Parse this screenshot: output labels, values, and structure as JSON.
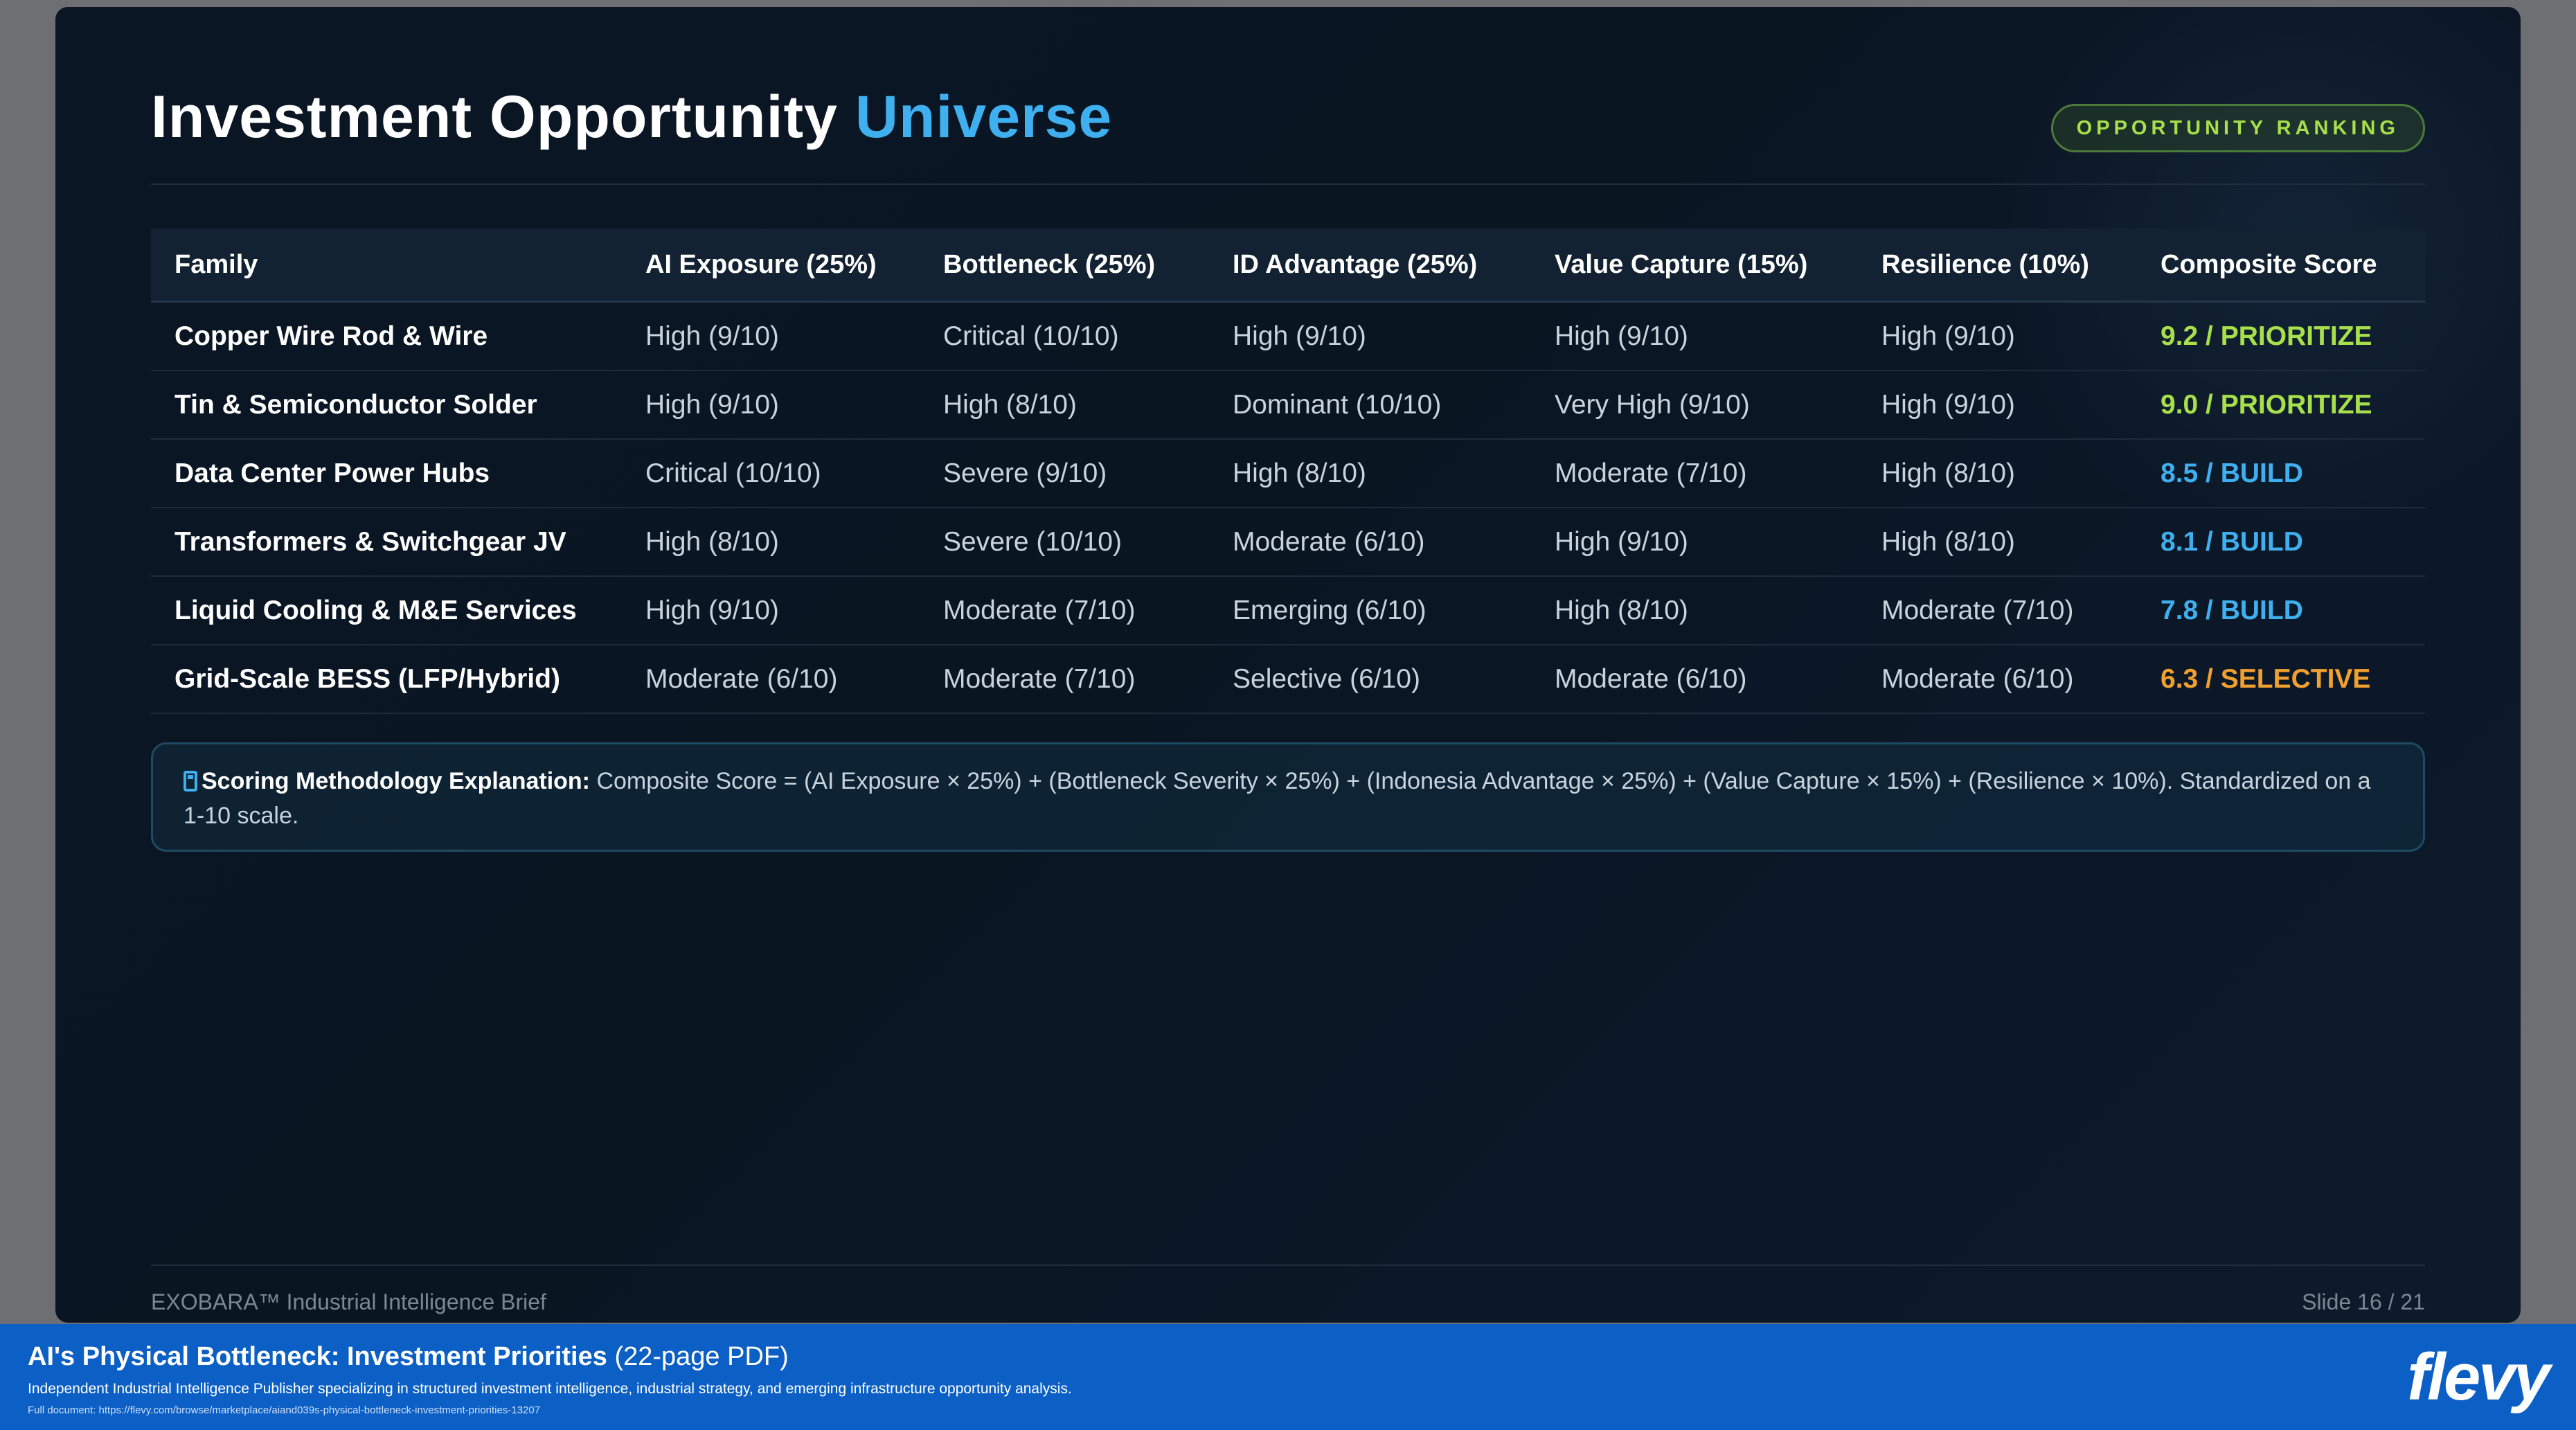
{
  "slide": {
    "title_main": "Investment Opportunity",
    "title_accent": "Universe",
    "badge": "OPPORTUNITY RANKING",
    "table": {
      "headers": [
        "Family",
        "AI Exposure (25%)",
        "Bottleneck (25%)",
        "ID Advantage (25%)",
        "Value Capture (15%)",
        "Resilience (10%)",
        "Composite Score"
      ],
      "rows": [
        {
          "family": "Copper Wire Rod & Wire",
          "ai": "High (9/10)",
          "bottleneck": "Critical (10/10)",
          "id_adv": "High (9/10)",
          "value": "High (9/10)",
          "resilience": "High (9/10)",
          "score": "9.2 / PRIORITIZE",
          "score_color": "#a7e04b"
        },
        {
          "family": "Tin & Semiconductor Solder",
          "ai": "High (9/10)",
          "bottleneck": "High (8/10)",
          "id_adv": "Dominant (10/10)",
          "value": "Very High (9/10)",
          "resilience": "High (9/10)",
          "score": "9.0 / PRIORITIZE",
          "score_color": "#a7e04b"
        },
        {
          "family": "Data Center Power Hubs",
          "ai": "Critical (10/10)",
          "bottleneck": "Severe (9/10)",
          "id_adv": "High (8/10)",
          "value": "Moderate (7/10)",
          "resilience": "High (8/10)",
          "score": "8.5 / BUILD",
          "score_color": "#3fb0ef"
        },
        {
          "family": "Transformers & Switchgear JV",
          "ai": "High (8/10)",
          "bottleneck": "Severe (10/10)",
          "id_adv": "Moderate (6/10)",
          "value": "High (9/10)",
          "resilience": "High (8/10)",
          "score": "8.1 / BUILD",
          "score_color": "#3fb0ef"
        },
        {
          "family": "Liquid Cooling & M&E Services",
          "ai": "High (9/10)",
          "bottleneck": "Moderate (7/10)",
          "id_adv": "Emerging (6/10)",
          "value": "High (8/10)",
          "resilience": "Moderate (7/10)",
          "score": "7.8 / BUILD",
          "score_color": "#3fb0ef"
        },
        {
          "family": "Grid-Scale BESS (LFP/Hybrid)",
          "ai": "Moderate (6/10)",
          "bottleneck": "Moderate (7/10)",
          "id_adv": "Selective (6/10)",
          "value": "Moderate (6/10)",
          "resilience": "Moderate (6/10)",
          "score": "6.3 / SELECTIVE",
          "score_color": "#f0a030"
        }
      ]
    },
    "note": {
      "icon": "calculator-icon",
      "label": "Scoring Methodology Explanation:",
      "text": "Composite Score = (AI Exposure × 25%) + (Bottleneck Severity × 25%) + (Indonesia Advantage × 25%) + (Value Capture × 15%) + (Resilience × 10%). Standardized on a 1-10 scale."
    },
    "footer_left": "EXOBARA™ Industrial Intelligence Brief",
    "footer_right": "Slide 16 / 21"
  },
  "banner": {
    "title": "AI's Physical Bottleneck: Investment Priorities",
    "pages": "(22-page PDF)",
    "description": "Independent Industrial Intelligence Publisher specializing in structured investment intelligence, industrial strategy, and emerging infrastructure opportunity analysis.",
    "url": "Full document: https://flevy.com/browse/marketplace/aiand039s-physical-bottleneck-investment-priorities-13207",
    "brand": "flevy"
  }
}
